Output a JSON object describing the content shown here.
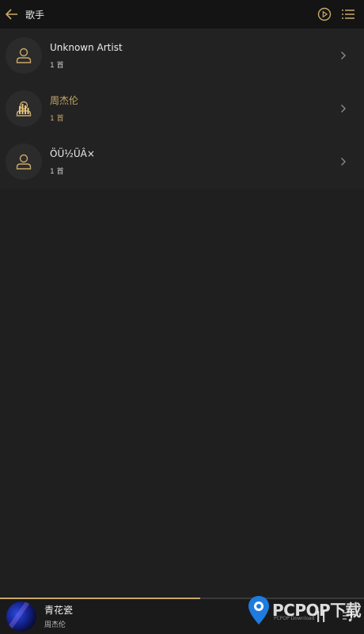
{
  "header": {
    "title": "歌手",
    "icons": [
      "back-arrow-icon",
      "play-circle-icon",
      "list-menu-icon"
    ],
    "accent_color": "#c9a86a"
  },
  "artists": [
    {
      "name": "Unknown Artist",
      "count": "1 首",
      "active": false
    },
    {
      "name": "周杰伦",
      "count": "1 首",
      "active": true
    },
    {
      "name": "ÖÜ½ÜÂ×",
      "count": "1 首",
      "active": false
    }
  ],
  "player": {
    "song_title": "青花瓷",
    "artist": "周杰伦",
    "progress": 0.55
  },
  "watermark": {
    "text": "PCPOP下载",
    "sub": "PCPOP Download"
  }
}
